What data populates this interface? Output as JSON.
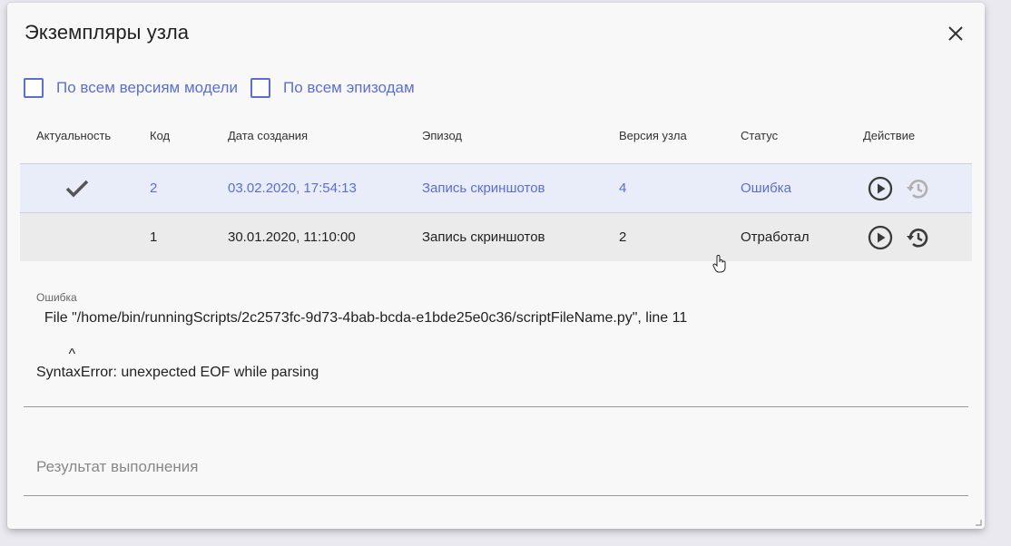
{
  "dialog": {
    "title": "Экземпляры узла"
  },
  "filters": {
    "all_model_versions": "По всем версиям модели",
    "all_episodes": "По всем эпизодам"
  },
  "table": {
    "headers": {
      "actuality": "Актуальность",
      "code": "Код",
      "created": "Дата создания",
      "episode": "Эпизод",
      "node_version": "Версия узла",
      "status": "Статус",
      "action": "Действие"
    },
    "rows": [
      {
        "actual": true,
        "code": "2",
        "created": "03.02.2020, 17:54:13",
        "episode": "Запись скриншотов",
        "node_version": "4",
        "status": "Ошибка"
      },
      {
        "actual": false,
        "code": "1",
        "created": "30.01.2020, 11:10:00",
        "episode": "Запись скриншотов",
        "node_version": "2",
        "status": "Отработал"
      }
    ]
  },
  "error": {
    "label": "Ошибка",
    "text": "  File \"/home/bin/runningScripts/2c2573fc-9d73-4bab-bcda-e1bde25e0c36/scriptFileName.py\", line 11\n\n        ^\nSyntaxError: unexpected EOF while parsing"
  },
  "result": {
    "placeholder": "Результат выполнения"
  },
  "colors": {
    "accent": "#5b6fd1",
    "selected_row": "#e9ecf9",
    "icon_dark": "#3a3a3a",
    "icon_disabled": "#b0b0b0"
  }
}
